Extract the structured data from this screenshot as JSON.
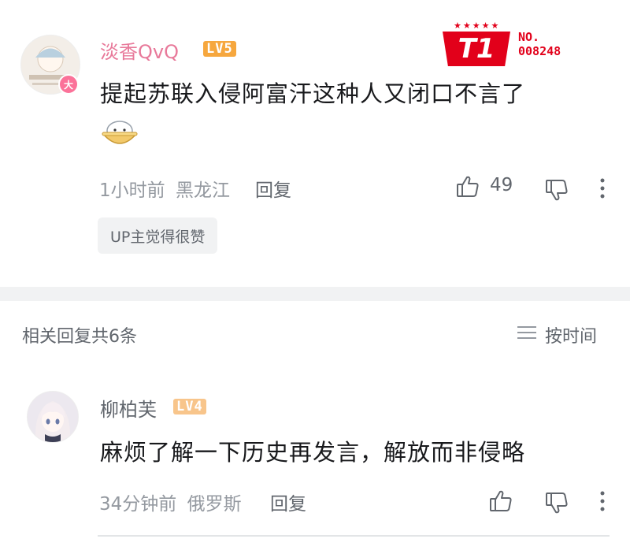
{
  "main_comment": {
    "username": "淡香QvQ",
    "level": "LV5",
    "avatar_badge": "大",
    "content": "提起苏联入侵阿富汗这种人又闭口不言了",
    "emoji": "bowl-emoji",
    "time": "1小时前",
    "location": "黑龙江",
    "reply_label": "回复",
    "like_count": "49",
    "tag": "UP主觉得很赞",
    "fan_badge": {
      "stars": "★★★★★",
      "logo": "T1",
      "number_label": "NO.",
      "number": "008248",
      "color": "#e2001a"
    }
  },
  "replies_header": {
    "count_label": "相关回复共6条",
    "sort_label": "按时间"
  },
  "reply_comment": {
    "username": "柳柏芙",
    "level": "LV4",
    "content": "麻烦了解一下历史再发言，解放而非侵略",
    "time": "34分钟前",
    "location": "俄罗斯",
    "reply_label": "回复"
  },
  "icons": [
    "thumb-up-icon",
    "thumb-down-icon",
    "more-icon",
    "sort-icon"
  ]
}
